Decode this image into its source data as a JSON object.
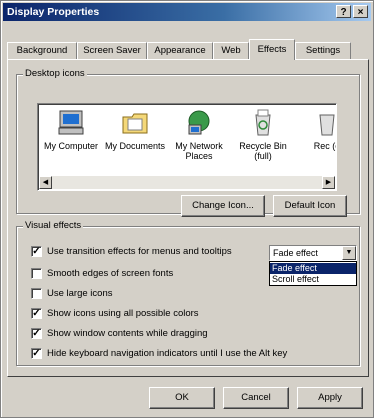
{
  "window": {
    "title": "Display Properties",
    "help_glyph": "?",
    "close_glyph": "×"
  },
  "tabs": [
    {
      "label": "Background"
    },
    {
      "label": "Screen Saver"
    },
    {
      "label": "Appearance"
    },
    {
      "label": "Web"
    },
    {
      "label": "Effects",
      "active": true
    },
    {
      "label": "Settings"
    }
  ],
  "desktop_icons": {
    "group_label": "Desktop icons",
    "items": [
      {
        "label": "My Computer",
        "icon": "my-computer-icon"
      },
      {
        "label": "My Documents",
        "icon": "my-documents-icon"
      },
      {
        "label": "My Network Places",
        "icon": "network-places-icon"
      },
      {
        "label": "Recycle Bin (full)",
        "icon": "recycle-bin-icon"
      },
      {
        "label": "Rec (e",
        "icon": "recycle-bin-icon"
      }
    ],
    "change_icon_label": "Change Icon...",
    "default_icon_label": "Default Icon"
  },
  "visual_effects": {
    "group_label": "Visual effects",
    "options": [
      {
        "label": "Use transition effects for menus and tooltips",
        "checked": true
      },
      {
        "label": "Smooth edges of screen fonts",
        "checked": false
      },
      {
        "label": "Use large icons",
        "checked": false
      },
      {
        "label": "Show icons using all possible colors",
        "checked": true
      },
      {
        "label": "Show window contents while dragging",
        "checked": true
      },
      {
        "label": "Hide keyboard navigation indicators until I use the Alt key",
        "checked": true
      }
    ],
    "transition_select": {
      "value": "Fade effect",
      "options": [
        "Fade effect",
        "Scroll effect"
      ],
      "highlighted": "Fade effect"
    }
  },
  "buttons": {
    "ok": "OK",
    "cancel": "Cancel",
    "apply": "Apply"
  },
  "colors": {
    "title_active": "#0a246a",
    "face": "#d4d0c8",
    "selection": "#0a246a"
  }
}
